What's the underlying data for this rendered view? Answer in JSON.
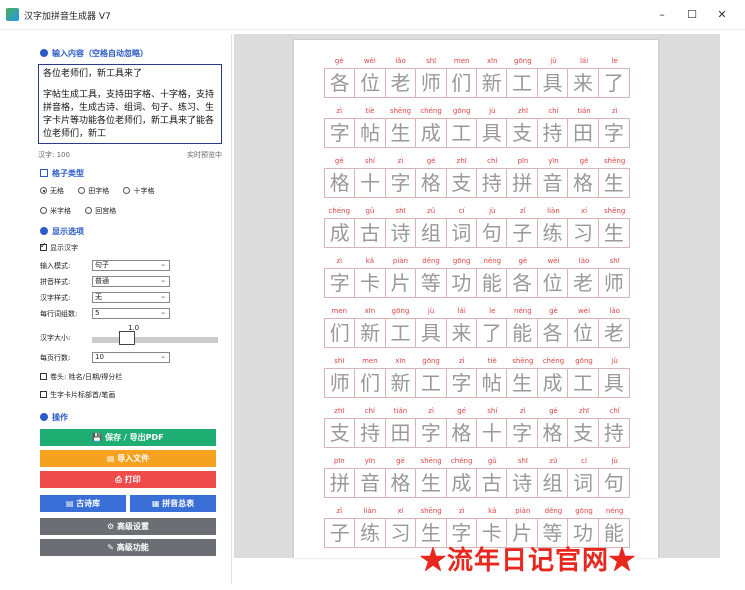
{
  "window": {
    "title": "汉字加拼音生成器 V7",
    "controls": [
      "–",
      "☐",
      "✕"
    ]
  },
  "sidebar": {
    "input_section": "输入内容（空格自动忽略）",
    "text_line1": "各位老师们，新工具来了",
    "text_body": "字帖生成工具，支持田字格、十字格，支持拼音格，生成古诗、组词、句子、练习、生字卡片等功能各位老师们，新工具来了能各位老师们，新工",
    "char_count": "汉字: 100",
    "preview_label": "实时预览中",
    "grid_section": "格子类型",
    "grid_options": [
      "无格",
      "田字格",
      "十字格",
      "米字格",
      "回宫格"
    ],
    "grid_selected": "无格",
    "display_section": "显示选项",
    "show_chars_label": "显示汉字",
    "fields": [
      {
        "label": "输入模式:",
        "value": "句子"
      },
      {
        "label": "拼音样式:",
        "value": "普通"
      },
      {
        "label": "汉字样式:",
        "value": "无"
      },
      {
        "label": "每行词组数:",
        "value": "5"
      }
    ],
    "font_size_label": "汉字大小:",
    "font_size_value": "1.0",
    "font_size_level": 0.5,
    "rows_label": "每页行数:",
    "rows_value": "10",
    "header_check_label": "卷头: 姓名/日期/得分栏",
    "card_check_label": "生字卡片标部首/笔画",
    "ops_section": "操作",
    "buttons": {
      "save": "保存 / 导出PDF",
      "import": "导入文件",
      "print": "打印",
      "poems": "古诗库",
      "pinyin_table": "拼音总表",
      "advanced_settings": "高级设置",
      "advanced_features": "高级功能"
    }
  },
  "sheet": {
    "rows": [
      {
        "pinyin": [
          "gè",
          "wèi",
          "lǎo",
          "shī",
          "men",
          "xīn",
          "gōng",
          "jù",
          "lái",
          "le"
        ],
        "chars": [
          "各",
          "位",
          "老",
          "师",
          "们",
          "新",
          "工",
          "具",
          "来",
          "了"
        ]
      },
      {
        "pinyin": [
          "zì",
          "tiè",
          "shēng",
          "chéng",
          "gōng",
          "jù",
          "zhī",
          "chí",
          "tián",
          "zì"
        ],
        "chars": [
          "字",
          "帖",
          "生",
          "成",
          "工",
          "具",
          "支",
          "持",
          "田",
          "字"
        ]
      },
      {
        "pinyin": [
          "gé",
          "shí",
          "zì",
          "gé",
          "zhī",
          "chí",
          "pīn",
          "yīn",
          "gé",
          "shēng"
        ],
        "chars": [
          "格",
          "十",
          "字",
          "格",
          "支",
          "持",
          "拼",
          "音",
          "格",
          "生"
        ]
      },
      {
        "pinyin": [
          "chéng",
          "gǔ",
          "shī",
          "zǔ",
          "cí",
          "jù",
          "zǐ",
          "liàn",
          "xí",
          "shēng"
        ],
        "chars": [
          "成",
          "古",
          "诗",
          "组",
          "词",
          "句",
          "子",
          "练",
          "习",
          "生"
        ]
      },
      {
        "pinyin": [
          "zì",
          "kǎ",
          "piàn",
          "děng",
          "gōng",
          "néng",
          "gè",
          "wèi",
          "lǎo",
          "shī"
        ],
        "chars": [
          "字",
          "卡",
          "片",
          "等",
          "功",
          "能",
          "各",
          "位",
          "老",
          "师"
        ]
      },
      {
        "pinyin": [
          "men",
          "xīn",
          "gōng",
          "jù",
          "lái",
          "le",
          "néng",
          "gè",
          "wèi",
          "lǎo"
        ],
        "chars": [
          "们",
          "新",
          "工",
          "具",
          "来",
          "了",
          "能",
          "各",
          "位",
          "老"
        ]
      },
      {
        "pinyin": [
          "shī",
          "men",
          "xīn",
          "gōng",
          "zì",
          "tiè",
          "shēng",
          "chéng",
          "gōng",
          "jù"
        ],
        "chars": [
          "师",
          "们",
          "新",
          "工",
          "字",
          "帖",
          "生",
          "成",
          "工",
          "具"
        ]
      },
      {
        "pinyin": [
          "zhī",
          "chí",
          "tián",
          "zì",
          "gé",
          "shí",
          "zì",
          "gé",
          "zhī",
          "chí"
        ],
        "chars": [
          "支",
          "持",
          "田",
          "字",
          "格",
          "十",
          "字",
          "格",
          "支",
          "持"
        ]
      },
      {
        "pinyin": [
          "pīn",
          "yīn",
          "gé",
          "shēng",
          "chéng",
          "gǔ",
          "shī",
          "zǔ",
          "cí",
          "jù"
        ],
        "chars": [
          "拼",
          "音",
          "格",
          "生",
          "成",
          "古",
          "诗",
          "组",
          "词",
          "句"
        ]
      },
      {
        "pinyin": [
          "zǐ",
          "liàn",
          "xí",
          "shēng",
          "zì",
          "kǎ",
          "piàn",
          "děng",
          "gōng",
          "néng"
        ],
        "chars": [
          "子",
          "练",
          "习",
          "生",
          "字",
          "卡",
          "片",
          "等",
          "功",
          "能"
        ]
      }
    ]
  },
  "watermark": "★流年日记官网★",
  "colors": {
    "pinyin": "#e04545",
    "accent": "#2b5bc7",
    "green": "#1eae74",
    "orange": "#f5a220",
    "red": "#ef4b4b",
    "blue": "#3a6fd8",
    "gray": "#6b6e73"
  }
}
